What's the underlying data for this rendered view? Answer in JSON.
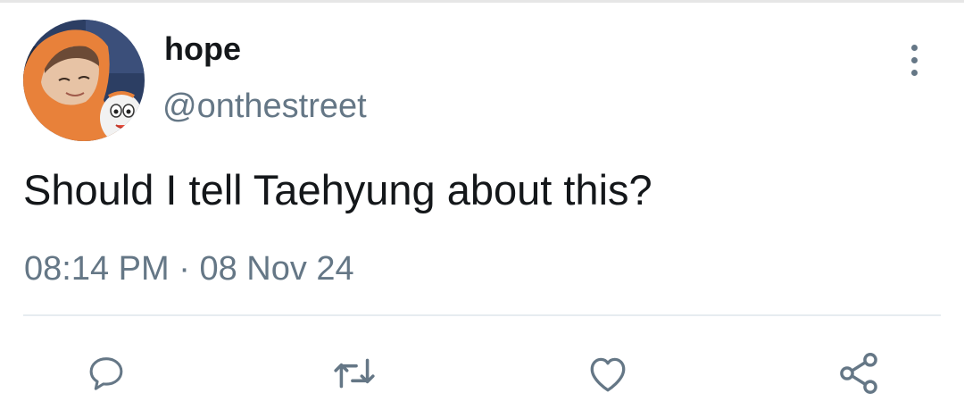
{
  "tweet": {
    "display_name": "hope",
    "handle": "@onthestreet",
    "text": "Should I tell Taehyung about this?",
    "time": "08:14 PM",
    "separator": "·",
    "date": "08 Nov 24"
  },
  "icons": {
    "more": "more-vertical-icon",
    "reply": "reply-icon",
    "retweet": "retweet-icon",
    "like": "heart-icon",
    "share": "share-icon"
  },
  "colors": {
    "text_primary": "#14171a",
    "text_secondary": "#657786",
    "divider": "#e6ecf0",
    "avatar_hood": "#e8813a"
  }
}
